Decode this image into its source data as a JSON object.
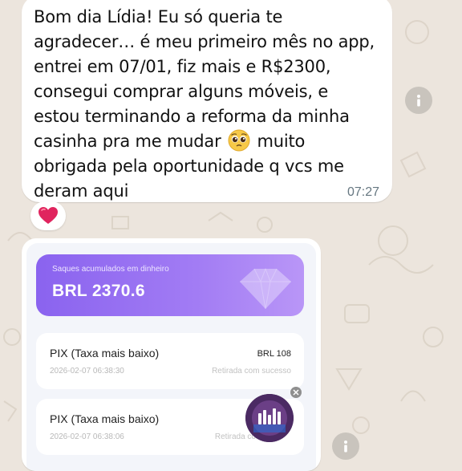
{
  "message": {
    "line1": "Bom dia Lídia! Eu só queria te",
    "line2": "agradecer… é meu primeiro mês no app,",
    "line3": "entrei em 07/01, fiz mais e R$2300,",
    "line4": "consegui comprar alguns móveis, e",
    "line5": "estou terminando a reforma da minha",
    "line6_before": "casinha pra me mudar",
    "line6_emoji": "pleading-face",
    "line6_after": "muito",
    "line7": "obrigada pela oportunidade q vcs me",
    "line8": "deram aqui",
    "time": "07:27",
    "reaction": "red-heart"
  },
  "screenshot": {
    "balance": {
      "label": "Saques acumulados em dinheiro",
      "value": "BRL 2370.6"
    },
    "transactions": [
      {
        "method": "PIX (Taxa mais baixo)",
        "date": "2026-02-07 06:38:30",
        "amount": "BRL 108",
        "status": "Retirada com sucesso"
      },
      {
        "method": "PIX (Taxa mais baixo)",
        "date": "2026-02-07 06:38:06",
        "amount": "",
        "status": "Retirada co"
      }
    ]
  },
  "colors": {
    "chat_background": "#ece5dd",
    "bubble": "#ffffff",
    "timestamp": "#667781",
    "balance_gradient_start": "#8a63ef",
    "balance_gradient_end": "#b996f7",
    "heart": "#e0245e"
  }
}
